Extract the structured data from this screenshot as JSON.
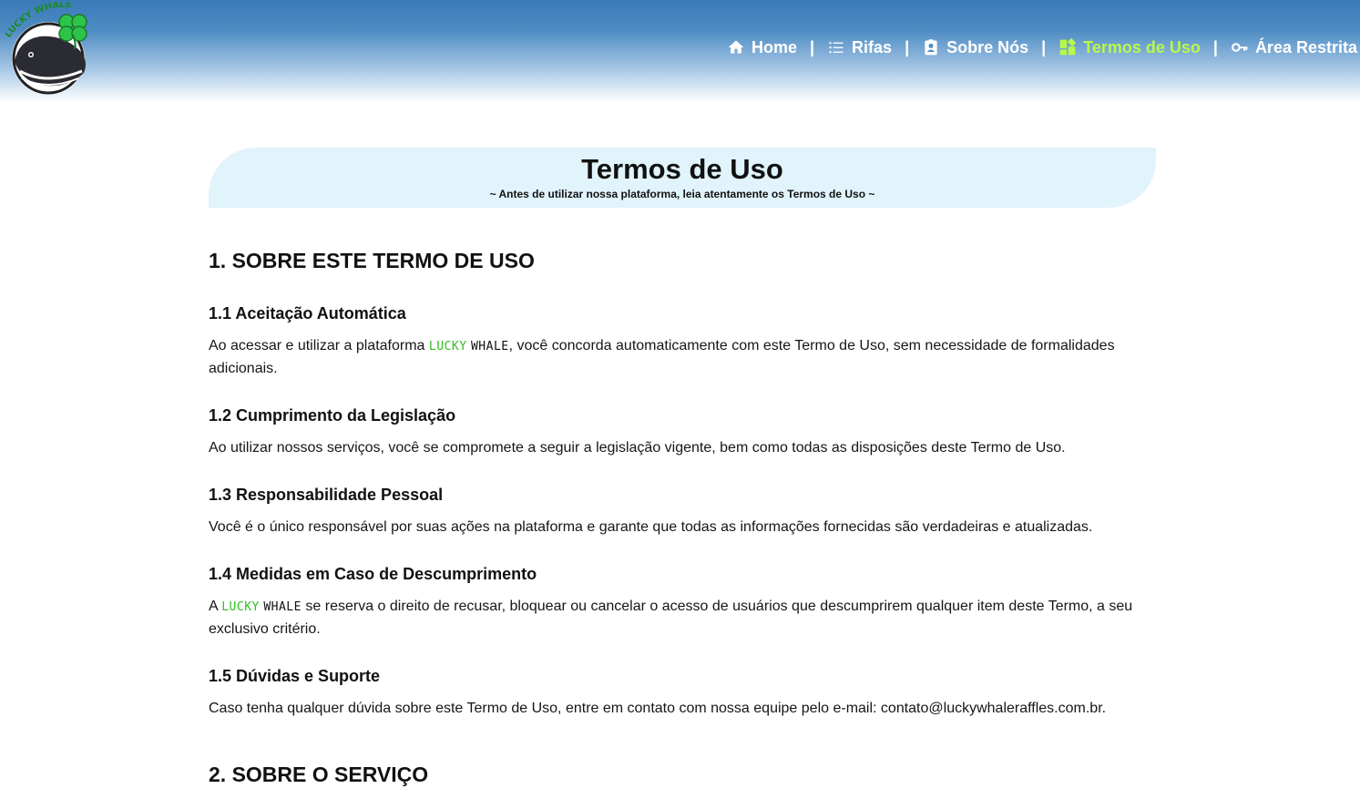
{
  "logo": {
    "text": "LUCKY WHALE"
  },
  "nav": {
    "items": [
      {
        "label": "Home",
        "icon": "home-icon"
      },
      {
        "label": "Rifas",
        "icon": "list-icon"
      },
      {
        "label": "Sobre Nós",
        "icon": "contact-card-icon"
      },
      {
        "label": "Termos de Uso",
        "icon": "dashboard-icon",
        "active": true
      },
      {
        "label": "Área Restrita",
        "icon": "key-icon"
      }
    ],
    "separator": "|"
  },
  "banner": {
    "title": "Termos de Uso",
    "subtitle": "~ Antes de utilizar nossa plataforma, leia atentamente os Termos de Uso ~"
  },
  "brand": {
    "lucky": "LUCKY",
    "whale": "WHALE"
  },
  "sections": [
    {
      "title": "1. SOBRE ESTE TERMO DE USO",
      "items": [
        {
          "title": "1.1 Aceitação Automática",
          "text_before": "Ao acessar e utilizar a plataforma ",
          "text_after": ", você concorda automaticamente com este Termo de Uso, sem necessidade de formalidades adicionais."
        },
        {
          "title": "1.2 Cumprimento da Legislação",
          "text": "Ao utilizar nossos serviços, você se compromete a seguir a legislação vigente, bem como todas as disposições deste Termo de Uso."
        },
        {
          "title": "1.3 Responsabilidade Pessoal",
          "text": "Você é o único responsável por suas ações na plataforma e garante que todas as informações fornecidas são verdadeiras e atualizadas."
        },
        {
          "title": "1.4 Medidas em Caso de Descumprimento",
          "text_before": "A ",
          "text_after": " se reserva o direito de recusar, bloquear ou cancelar o acesso de usuários que descumprirem qualquer item deste Termo, a seu exclusivo critério."
        },
        {
          "title": "1.5 Dúvidas e Suporte",
          "text": "Caso tenha qualquer dúvida sobre este Termo de Uso, entre em contato com nossa equipe pelo e-mail: contato@luckywhaleraffles.com.br."
        }
      ]
    },
    {
      "title": "2. SOBRE O SERVIÇO"
    }
  ],
  "colors": {
    "header_top": "#3a7ab8",
    "nav_active": "#b9f84a",
    "banner_bg": "#e1f3fb",
    "brand_green": "#2fbf1e"
  }
}
